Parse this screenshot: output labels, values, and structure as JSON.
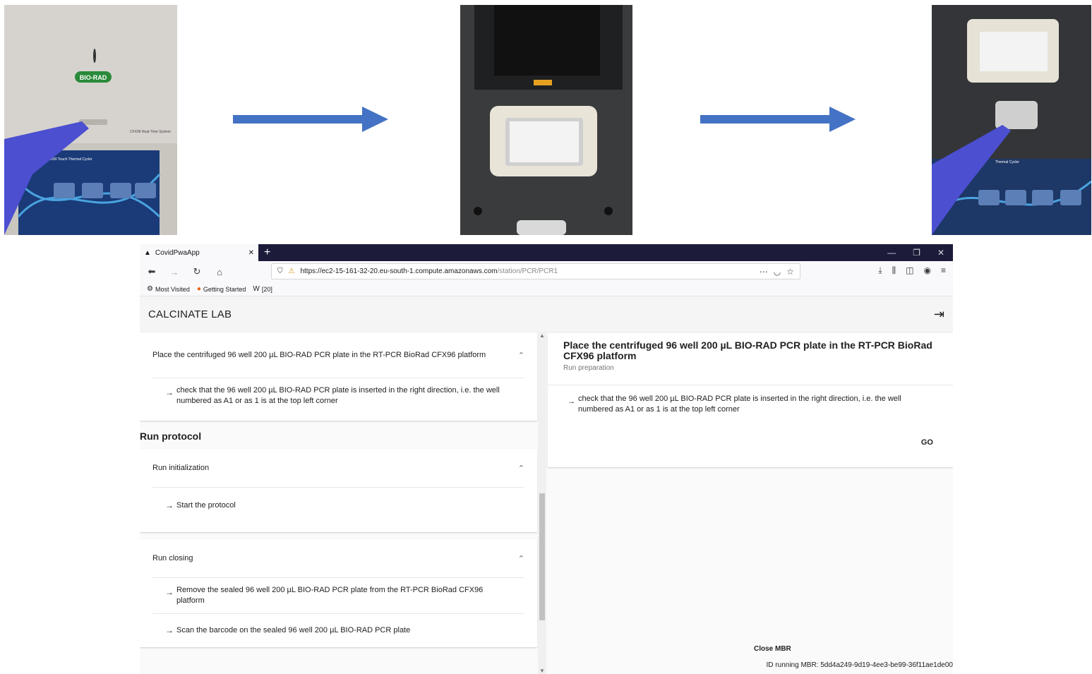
{
  "photos": {
    "photo1": {
      "logo": "BIO-RAD",
      "model": "CFX96 Real-Time System",
      "screen_title": "C1000 Touch Thermal Cycler"
    },
    "photo3": {
      "screen_title": "Thermal Cycler"
    }
  },
  "colors": {
    "arrow": "#4472c4",
    "tabbar": "#1c1b3a"
  },
  "browser": {
    "tab_title": "CovidPwaApp",
    "new_tab": "+",
    "url_host": "https://ec2-15-161-32-20.eu-south-1.compute.amazonaws.com",
    "url_path": "/station/PCR/PCR1",
    "bookmarks": [
      "Most Visited",
      "Getting Started",
      "[20]"
    ]
  },
  "app": {
    "title": "CALCINATE LAB"
  },
  "left": {
    "place_card": {
      "header": "Place the centrifuged 96 well 200 µL BIO-RAD PCR plate in the RT-PCR BioRad CFX96 platform",
      "steps": [
        "check that the 96 well 200 µL BIO-RAD PCR plate is inserted in the right direction, i.e. the well numbered as A1 or as 1 is at the top left corner"
      ]
    },
    "section": "Run protocol",
    "init_card": {
      "header": "Run initialization",
      "steps": [
        "Start the protocol"
      ]
    },
    "closing_card": {
      "header": "Run closing",
      "steps": [
        "Remove the sealed 96 well 200 µL BIO-RAD PCR plate from the RT-PCR BioRad CFX96 platform",
        "Scan the barcode on the sealed 96 well 200 µL BIO-RAD PCR plate"
      ]
    }
  },
  "right": {
    "title": "Place the centrifuged 96 well 200 µL BIO-RAD PCR plate in the RT-PCR BioRad CFX96 platform",
    "subtitle": "Run preparation",
    "step": "check that the 96 well 200 µL BIO-RAD PCR plate is inserted in the right direction, i.e. the well numbered as A1 or as 1 is at the top left corner",
    "go": "GO"
  },
  "footer": {
    "close_mbr": "Close MBR",
    "id_running": "ID running MBR: 5dd4a249-9d19-4ee3-be99-36f11ae1de00"
  }
}
